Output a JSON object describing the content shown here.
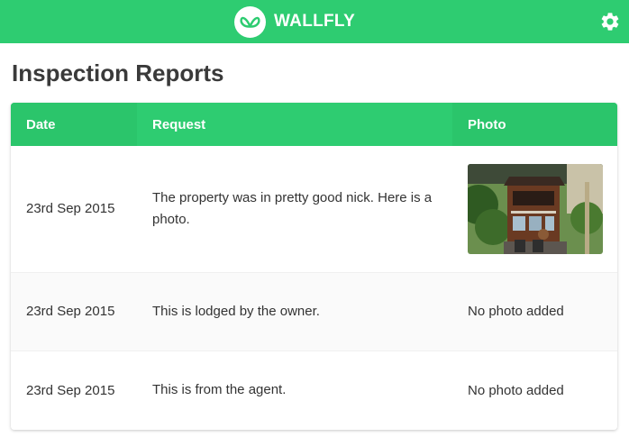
{
  "header": {
    "brand": "WALLFLY",
    "logo_icon": "wallfly-logo-icon",
    "settings_icon": "gear-icon"
  },
  "page": {
    "title": "Inspection Reports"
  },
  "table": {
    "columns": [
      "Date",
      "Request",
      "Photo"
    ],
    "rows": [
      {
        "date": "23rd Sep 2015",
        "request": "The property was in pretty good nick. Here is a photo.",
        "photo": "photo-thumbnail"
      },
      {
        "date": "23rd Sep 2015",
        "request": "This is lodged by the owner.",
        "photo": "No photo added"
      },
      {
        "date": "23rd Sep 2015",
        "request": "This is from the agent.",
        "photo": "No photo added"
      }
    ]
  },
  "colors": {
    "brand_green": "#2ecc71",
    "text": "#333333",
    "title": "#3a3a3a"
  }
}
